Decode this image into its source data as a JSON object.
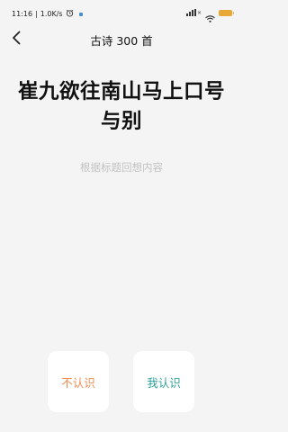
{
  "status_bar": {
    "time": "11:16",
    "separator": "|",
    "speed": "1.0K/s",
    "icons": [
      "alarm-icon",
      "notification-dot-icon",
      "signal-icon",
      "wifi-icon",
      "battery-icon"
    ]
  },
  "header": {
    "back_icon": "chevron-left-icon",
    "title": "古诗 300 首"
  },
  "main": {
    "poem_title": "崔九欲往南山马上口号与别",
    "hint": "根据标题回想内容"
  },
  "actions": {
    "unknown_label": "不认识",
    "known_label": "我认识"
  },
  "colors": {
    "background": "#f4f4f4",
    "unknown_text": "#ef8b4e",
    "known_text": "#2e9f99",
    "hint_text": "#c2c2c2",
    "battery": "#e8a838"
  }
}
